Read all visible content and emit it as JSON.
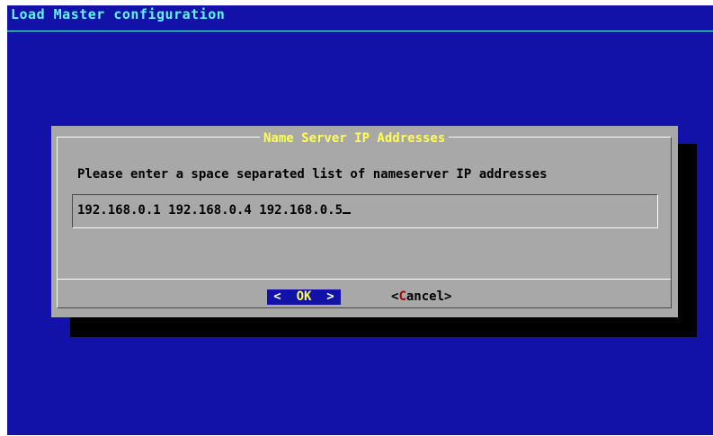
{
  "backtitle": "Load Master configuration",
  "dialog": {
    "title": "Name Server IP Addresses",
    "prompt": "Please enter a space separated list of nameserver IP addresses",
    "input_value": "192.168.0.1 192.168.0.4 192.168.0.5"
  },
  "buttons": {
    "ok": {
      "left": "<",
      "hotkey": "O",
      "rest": "K",
      "right": ">"
    },
    "cancel": {
      "open": "<",
      "hotkey": "C",
      "rest": "ancel",
      "close": ">"
    }
  },
  "colors": {
    "screen_bg": "#1212a8",
    "backtitle": "#5ff6ff",
    "dialog_bg": "#a8a8a8",
    "title": "#ffff54",
    "hotkey_cancel": "#a80000"
  }
}
